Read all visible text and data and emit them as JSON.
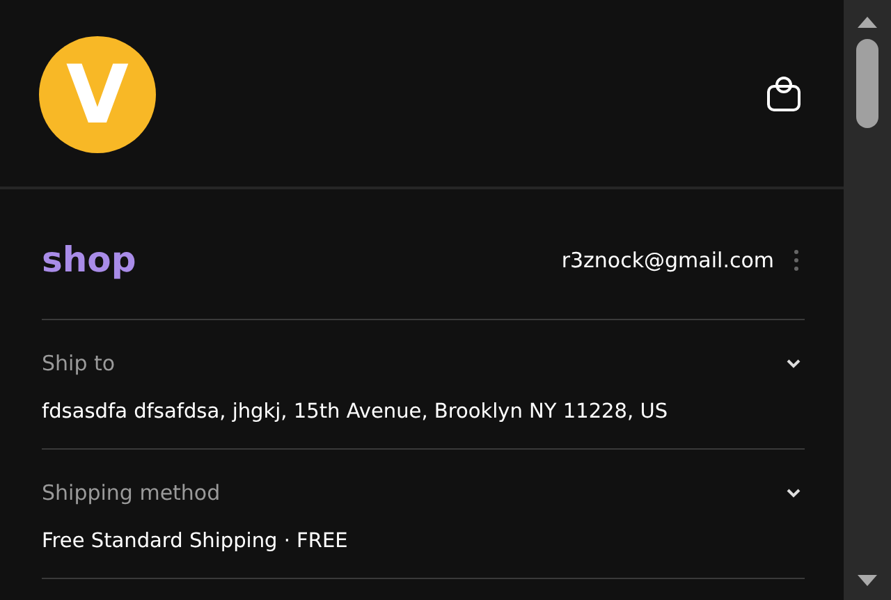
{
  "header": {
    "logo_letter": "V"
  },
  "account": {
    "brand": "shop",
    "email": "r3znock@gmail.com"
  },
  "sections": [
    {
      "label": "Ship to",
      "value": "fdsasdfa dfsafdsa, jhgkj, 15th Avenue, Brooklyn NY 11228, US",
      "expanded": false
    },
    {
      "label": "Shipping method",
      "value": "Free Standard Shipping · FREE",
      "expanded": false
    }
  ]
}
